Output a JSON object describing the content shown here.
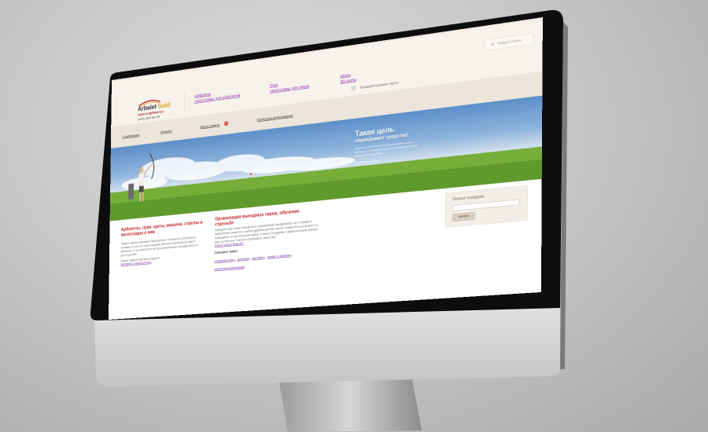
{
  "site": {
    "logo": {
      "name_part1": "Arbalet",
      "name_part2": "Gold",
      "tagline": "луки и арбалеты",
      "phone": "(495) 504-66-56"
    },
    "header_links": {
      "col1": [
        "Арбалеты",
        "Аксессуары для арбалетов"
      ],
      "col2": [
        "Луки",
        "Аксессуары для луков"
      ],
      "col3": [
        "Щиты",
        "3D щиты"
      ]
    },
    "login_label": "вход в сайты",
    "cart_text": "В вашей корзине пусто",
    "nav": {
      "about": "О компании",
      "catalog": "Каталог",
      "order": "Заказ товара",
      "info": "Полезная информация"
    },
    "hero": {
      "title": "Такая цель",
      "subtitle": "оправдывает средства!",
      "text": "Звоните (495) 504-66-56 консультаций в луке и арбалеты от ведущих мировых производителей в вашем распоряжении"
    },
    "content": {
      "left_heading": "Арбалеты, луки, щиты, мишени, стрелы и аксессуары к ним",
      "left_text": "Товары нашего магазина заинтересуют и бывалого спортсмена-лучника, и того, кто лишь недавно увлекся стрельбой из лука и арбалета. У нас имеются и все дополнительные принадлежности для стрельбы.",
      "left_small": "Ищете подарок для своего друга?",
      "left_link": "Загляните к нам в каталог!",
      "mid_heading": "Организация выездных тиров, обучение стрельбе",
      "mid_text": "Наберите нам номер телефона и современный передвижной тир с луками и арбалетами окажется в любом удобном для вас месте. Разместить его можно и в помещении, и под открытым небом. А наши сотрудники с удовольствием помогут вам постичь все тонкости стрелкового искусства.",
      "mid_link": "Хотите узнать больше?",
      "see_also_label": "Смотрите также:",
      "see_also_links": [
        "сотрудничество",
        "дилерам",
        "доставка",
        "сервис и гарантии",
        "контактная информация"
      ]
    },
    "search": {
      "heading": "Поиск товаров",
      "button": "искать!"
    }
  },
  "colors": {
    "accent_red": "#c2262a",
    "link_purple": "#8f2fb0",
    "header_bg": "#f7f2ec",
    "nav_bg": "#ece5dc"
  }
}
